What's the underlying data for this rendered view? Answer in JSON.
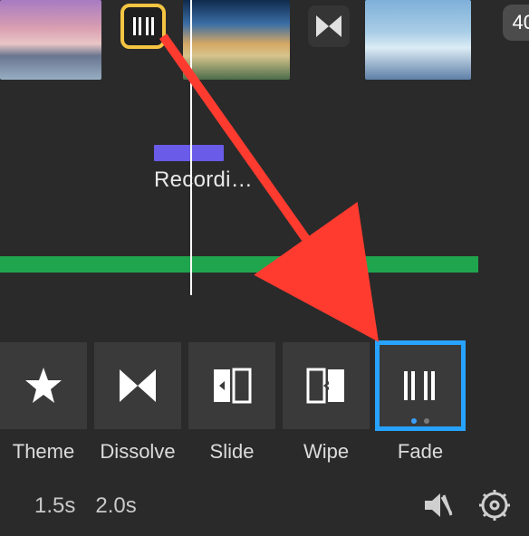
{
  "timeline": {
    "audio_label": "Recordi…",
    "badge": "40"
  },
  "transitions": [
    {
      "id": "theme",
      "label": "Theme"
    },
    {
      "id": "dissolve",
      "label": "Dissolve"
    },
    {
      "id": "slide",
      "label": "Slide"
    },
    {
      "id": "wipe",
      "label": "Wipe"
    },
    {
      "id": "fade",
      "label": "Fade"
    }
  ],
  "selected_transition": "fade",
  "durations": [
    "1.5s",
    "2.0s"
  ],
  "icons": {
    "mute": "mute-icon",
    "settings": "gear-icon"
  }
}
